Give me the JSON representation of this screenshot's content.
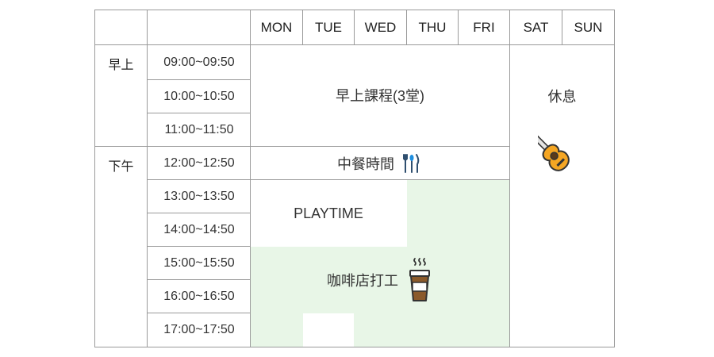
{
  "header": {
    "days": [
      "MON",
      "TUE",
      "WED",
      "THU",
      "FRI",
      "SAT",
      "SUN"
    ]
  },
  "periods": {
    "morning": "早上",
    "afternoon": "下午"
  },
  "times": [
    "09:00~09:50",
    "10:00~10:50",
    "11:00~11:50",
    "12:00~12:50",
    "13:00~13:50",
    "14:00~14:50",
    "15:00~15:50",
    "16:00~16:50",
    "17:00~17:50"
  ],
  "events": {
    "morning_class": "早上課程(3堂)",
    "lunch": "中餐時間",
    "playtime": "PLAYTIME",
    "cafe": "咖啡店打工",
    "rest": "休息"
  },
  "icons": {
    "lunch": "fork-spoon-knife-icon",
    "cafe": "hot-coffee-cup-icon",
    "rest": "guitar-icon"
  },
  "colors": {
    "grid": "#9a9a9a",
    "cafe_background": "#e8f6e7",
    "coffee": "#8b5a2b",
    "guitar": "#f5a623"
  }
}
